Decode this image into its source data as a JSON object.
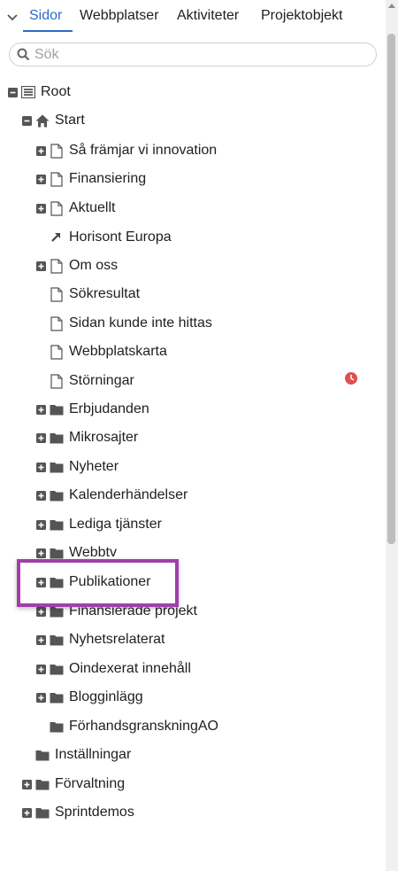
{
  "tabs": [
    {
      "label": "Sidor",
      "active": true
    },
    {
      "label": "Webbplatser",
      "active": false
    },
    {
      "label": "Aktiviteter",
      "active": false
    },
    {
      "label": "Projektobjekt",
      "active": false
    }
  ],
  "search": {
    "placeholder": "Sök",
    "value": ""
  },
  "tree": [
    {
      "label": "Root",
      "icon": "root-list-icon",
      "expander": "minus"
    },
    {
      "label": "Start",
      "icon": "home-icon",
      "expander": "minus"
    },
    {
      "label": "Så främjar vi innovation",
      "icon": "page-icon",
      "expander": "plus"
    },
    {
      "label": "Finansiering",
      "icon": "page-icon",
      "expander": "plus"
    },
    {
      "label": "Aktuellt",
      "icon": "page-icon",
      "expander": "plus"
    },
    {
      "label": "Horisont Europa",
      "icon": "shortcut-icon",
      "expander": "none"
    },
    {
      "label": "Om oss",
      "icon": "page-icon",
      "expander": "plus"
    },
    {
      "label": "Sökresultat",
      "icon": "page-icon",
      "expander": "none"
    },
    {
      "label": "Sidan kunde inte hittas",
      "icon": "page-icon",
      "expander": "none"
    },
    {
      "label": "Webbplatskarta",
      "icon": "page-icon",
      "expander": "none"
    },
    {
      "label": "Störningar",
      "icon": "page-icon",
      "expander": "none",
      "status": "scheduled-clock-icon"
    },
    {
      "label": "Erbjudanden",
      "icon": "folder-icon",
      "expander": "plus"
    },
    {
      "label": "Mikrosajter",
      "icon": "folder-icon",
      "expander": "plus"
    },
    {
      "label": "Nyheter",
      "icon": "folder-icon",
      "expander": "plus"
    },
    {
      "label": "Kalenderhändelser",
      "icon": "folder-icon",
      "expander": "plus"
    },
    {
      "label": "Lediga tjänster",
      "icon": "folder-icon",
      "expander": "plus"
    },
    {
      "label": "Webbtv",
      "icon": "folder-icon",
      "expander": "plus"
    },
    {
      "label": "Publikationer",
      "icon": "folder-icon",
      "expander": "plus",
      "highlighted": true
    },
    {
      "label": "Finansierade projekt",
      "icon": "folder-icon",
      "expander": "plus"
    },
    {
      "label": "Nyhetsrelaterat",
      "icon": "folder-icon",
      "expander": "plus"
    },
    {
      "label": "Oindexerat innehåll",
      "icon": "folder-icon",
      "expander": "plus"
    },
    {
      "label": "Blogginlägg",
      "icon": "folder-icon",
      "expander": "plus"
    },
    {
      "label": "FörhandsgranskningAO",
      "icon": "folder-icon",
      "expander": "none"
    },
    {
      "label": "Inställningar",
      "icon": "folder-icon",
      "expander": "none"
    },
    {
      "label": "Förvaltning",
      "icon": "folder-icon",
      "expander": "plus"
    },
    {
      "label": "Sprintdemos",
      "icon": "folder-icon",
      "expander": "plus"
    }
  ],
  "colors": {
    "accent": "#2b6cc4",
    "highlight": "#a040a8",
    "status_red": "#e05050",
    "icon_dark": "#555555"
  }
}
